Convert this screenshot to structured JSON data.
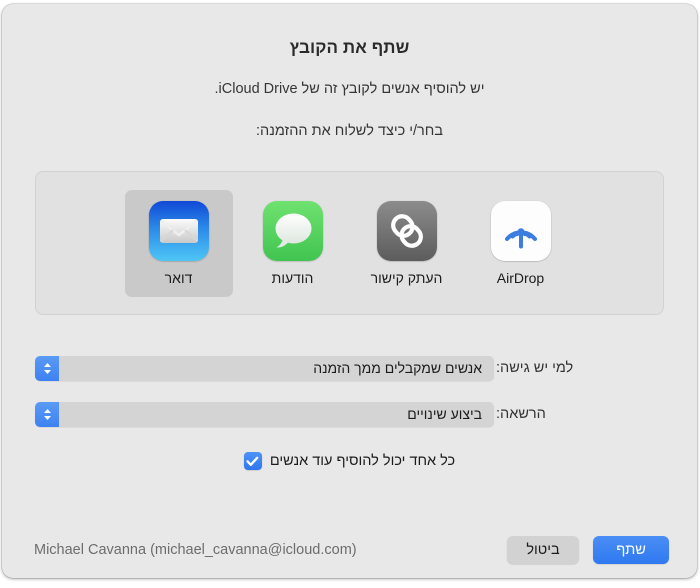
{
  "dialog": {
    "title": "שתף את הקובץ",
    "subtitle_line1": "יש להוסיף אנשים לקובץ זה של iCloud Drive.",
    "subtitle_line2": "בחר/י כיצד לשלוח את ההזמנה:"
  },
  "share_targets": [
    {
      "id": "airdrop",
      "label": "AirDrop",
      "icon": "airdrop-icon",
      "selected": false
    },
    {
      "id": "copy-link",
      "label": "העתק קישור",
      "icon": "link-icon",
      "selected": false
    },
    {
      "id": "messages",
      "label": "הודעות",
      "icon": "messages-icon",
      "selected": false
    },
    {
      "id": "mail",
      "label": "דואר",
      "icon": "mail-icon",
      "selected": true
    }
  ],
  "options": {
    "access": {
      "label": "למי יש גישה:",
      "value": "אנשים שמקבלים ממך הזמנה"
    },
    "permission": {
      "label": "הרשאה:",
      "value": "ביצוע שינויים"
    },
    "anyone_can_add": {
      "label": "כל אחד יכול להוסיף עוד אנשים",
      "checked": true
    }
  },
  "footer": {
    "share_label": "שתף",
    "cancel_label": "ביטול",
    "account": "Michael Cavanna (michael_cavanna@icloud.com)"
  },
  "colors": {
    "accent_blue": "#2f79f0",
    "window_bg": "#e8e8e8",
    "panel_bg": "#e1e1e1",
    "selection_gray": "#c9c9c9"
  }
}
